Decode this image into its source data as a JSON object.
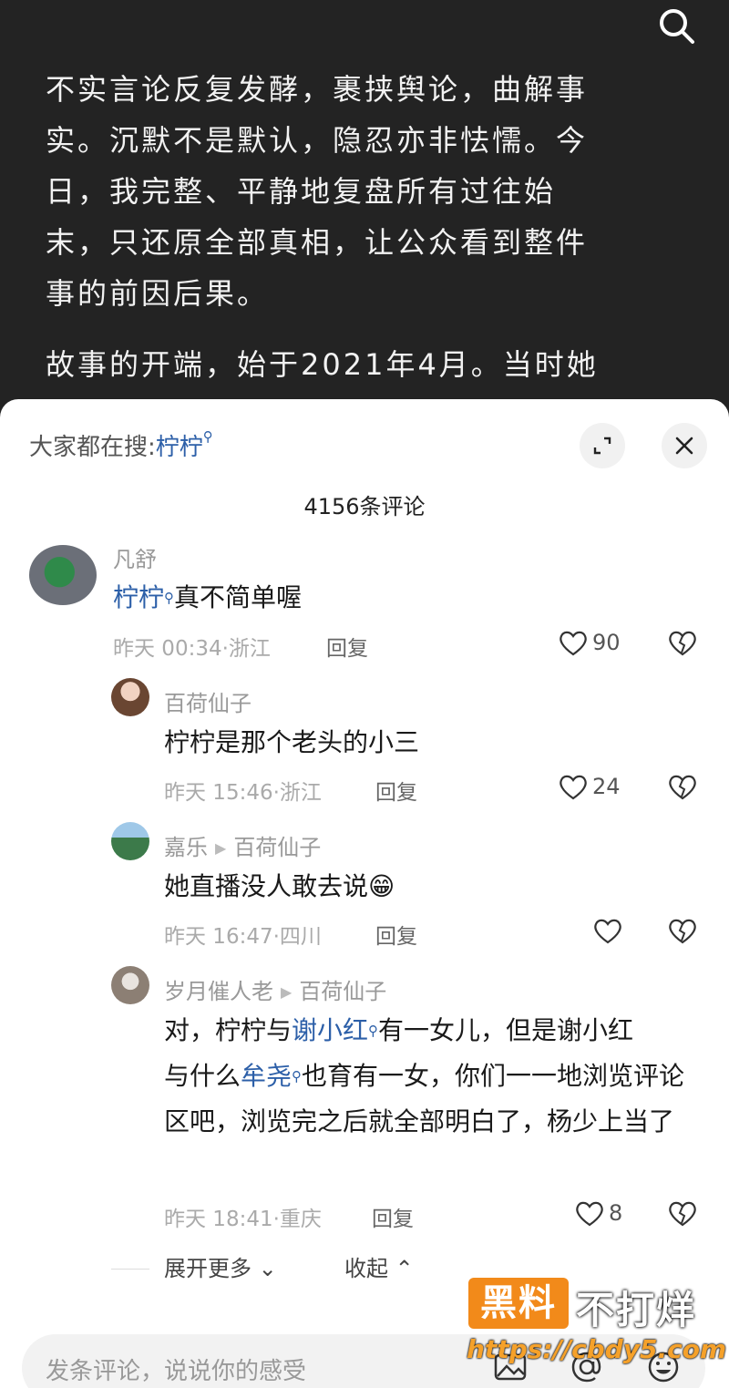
{
  "article": {
    "paragraphs": [
      "不实言论反复发酵，裹挟舆论，曲解事实。沉默不是默认，隐忍亦非怯懦。今日，我完整、平静地复盘所有过往始末，只还原全部真相，让公众看到整件事的前因后果。",
      "故事的开端，始于2021年4月。当时她"
    ]
  },
  "sheet": {
    "hot_search_prefix": "大家都在搜:",
    "hot_search_keyword": "柠柠",
    "comment_count": "4156条评论"
  },
  "comments": [
    {
      "name": "凡舒",
      "reply_to": "",
      "text_parts": [
        {
          "t": "柠柠",
          "link": true
        },
        {
          "t": "真不简单喔",
          "link": false
        }
      ],
      "time": "昨天 00:34·浙江",
      "reply": "回复",
      "likes": "90"
    },
    {
      "name": "百荷仙子",
      "reply_to": "",
      "text": "柠柠是那个老头的小三",
      "time": "昨天 15:46·浙江",
      "reply": "回复",
      "likes": "24"
    },
    {
      "name": "嘉乐",
      "reply_to": "百荷仙子",
      "text": "她直播没人敢去说",
      "emoji": "😁",
      "time": "昨天 16:47·四川",
      "reply": "回复",
      "likes": ""
    },
    {
      "name": "岁月催人老",
      "reply_to": "百荷仙子",
      "text_parts": [
        {
          "t": "对，柠柠与",
          "link": false
        },
        {
          "t": "谢小红",
          "link": true
        },
        {
          "t": "有一女儿，但是谢小红",
          "link": false
        },
        {
          "t": "与什么",
          "link": false
        },
        {
          "t": "牟尧",
          "link": true
        },
        {
          "t": "也育有一女，你们一一地浏览评论区吧，浏览完之后就全部明白了，杨少上当了",
          "link": false
        }
      ],
      "time": "昨天 18:41·重庆",
      "reply": "回复",
      "likes": "8"
    }
  ],
  "more": {
    "expand": "展开更多",
    "collapse": "收起"
  },
  "input": {
    "placeholder": "发条评论，说说你的感受"
  },
  "watermark": {
    "box": "黑料",
    "rest": "不打烊",
    "url": "https://cbdy5.com"
  },
  "colors": {
    "link": "#2c5fa8",
    "article_bg": "#232323",
    "watermark_orange": "#f28a1a"
  }
}
